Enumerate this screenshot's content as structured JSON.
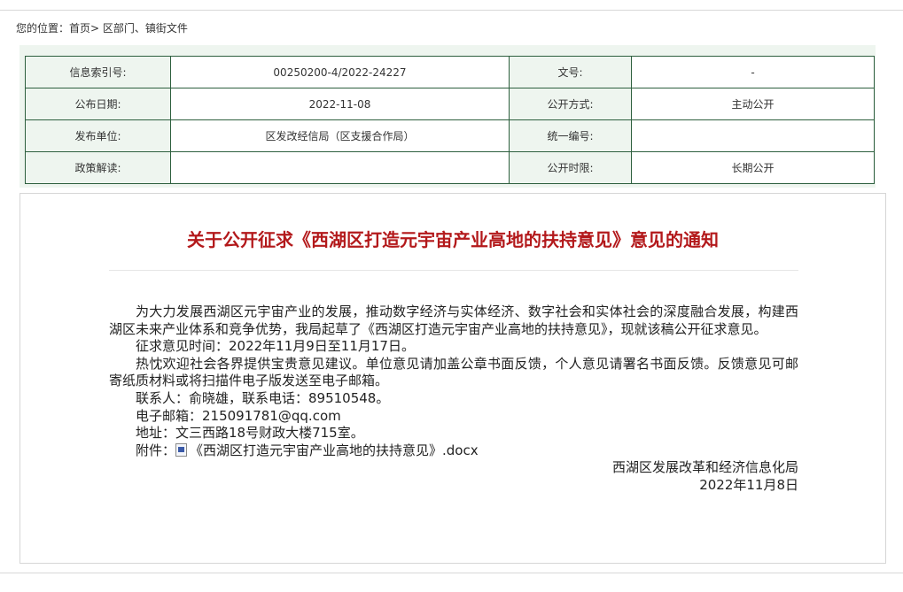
{
  "breadcrumb": {
    "prefix": "您的位置：",
    "home": "首页",
    "sep": ">",
    "section": "区部门、镇街文件"
  },
  "meta": {
    "rows": [
      {
        "l1": "信息索引号:",
        "v1": "00250200-4/2022-24227",
        "l2": "文号:",
        "v2": "-"
      },
      {
        "l1": "公布日期:",
        "v1": "2022-11-08",
        "l2": "公开方式:",
        "v2": "主动公开"
      },
      {
        "l1": "发布单位:",
        "v1": "区发改经信局（区支援合作局）",
        "l2": "统一编号:",
        "v2": ""
      },
      {
        "l1": "政策解读:",
        "v1": "",
        "l2": "公开时限:",
        "v2": "长期公开"
      }
    ]
  },
  "article": {
    "title": "关于公开征求《西湖区打造元宇宙产业高地的扶持意见》意见的通知",
    "paragraphs": {
      "p1": "为大力发展西湖区元宇宙产业的发展，推动数字经济与实体经济、数字社会和实体社会的深度融合发展，构建西湖区未来产业体系和竞争优势，我局起草了《西湖区打造元宇宙产业高地的扶持意见》，现就该稿公开征求意见。",
      "p2": "征求意见时间：2022年11月9日至11月17日。",
      "p3": "热忱欢迎社会各界提供宝贵意见建议。单位意见请加盖公章书面反馈，个人意见请署名书面反馈。反馈意见可邮寄纸质材料或将扫描件电子版发送至电子邮箱。",
      "p4": "联系人：俞晓雄，联系电话：89510548。",
      "p5": "电子邮箱：215091781@qq.com",
      "p6": "地址：文三西路18号财政大楼715室。"
    },
    "attachment_label": "附件：",
    "attachment_icon": "word-doc-icon",
    "attachment_file": "《西湖区打造元宇宙产业高地的扶持意见》.docx",
    "signature_org": "西湖区发展改革和经济信息化局",
    "signature_date": "2022年11月8日"
  },
  "colors": {
    "title": "#b3191b",
    "table_border": "#2d5f3e",
    "label_bg": "#eef5ef"
  }
}
